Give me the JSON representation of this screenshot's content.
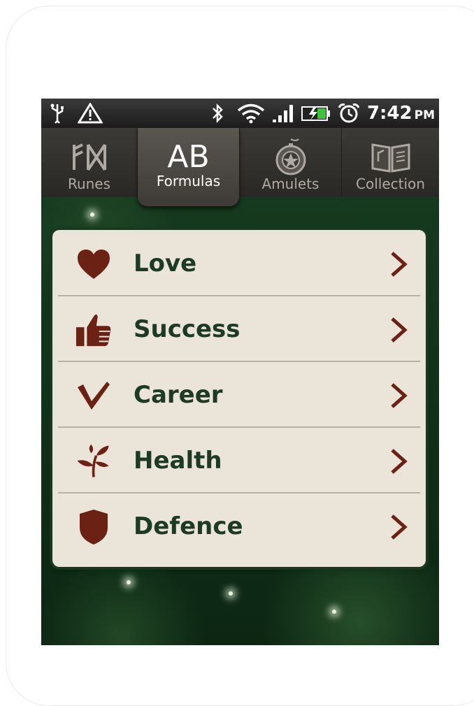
{
  "status_bar": {
    "time": "7:42",
    "ampm": "PM",
    "icons": [
      "usb-icon",
      "warning-icon",
      "bluetooth-icon",
      "wifi-icon",
      "signal-icon",
      "battery-icon",
      "alarm-icon"
    ]
  },
  "tabs": [
    {
      "label": "Runes",
      "icon": "runes-icon",
      "active": false
    },
    {
      "label": "Formulas",
      "icon": "ab-icon",
      "glyph": "AB",
      "active": true
    },
    {
      "label": "Amulets",
      "icon": "amulet-icon",
      "active": false
    },
    {
      "label": "Collection",
      "icon": "book-icon",
      "active": false
    }
  ],
  "menu": {
    "items": [
      {
        "label": "Love",
        "icon": "heart-icon"
      },
      {
        "label": "Success",
        "icon": "thumbs-up-icon"
      },
      {
        "label": "Career",
        "icon": "checkmark-icon"
      },
      {
        "label": "Health",
        "icon": "sprout-icon"
      },
      {
        "label": "Defence",
        "icon": "shield-icon"
      }
    ]
  },
  "colors": {
    "accent": "#6b2114",
    "text": "#1d3a26",
    "card": "#ebe4d8",
    "background": "#0f2a17"
  }
}
